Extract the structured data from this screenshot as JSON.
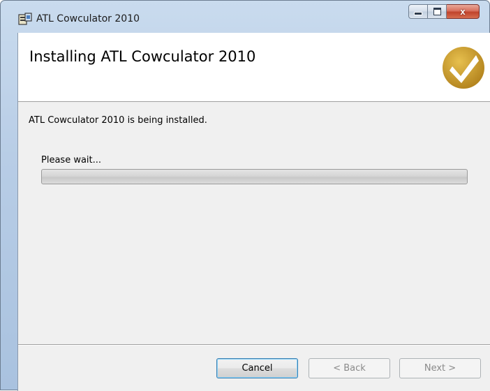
{
  "window": {
    "title": "ATL Cowculator 2010",
    "close_glyph": "x"
  },
  "header": {
    "title": "Installing ATL Cowculator 2010",
    "logo_icon": "checkmark-badge-icon",
    "logo_color": "#c89b2a"
  },
  "body": {
    "status": "ATL Cowculator 2010 is being installed.",
    "wait_label": "Please wait...",
    "progress": 0
  },
  "buttons": {
    "cancel": "Cancel",
    "back": "< Back",
    "next": "Next >"
  }
}
